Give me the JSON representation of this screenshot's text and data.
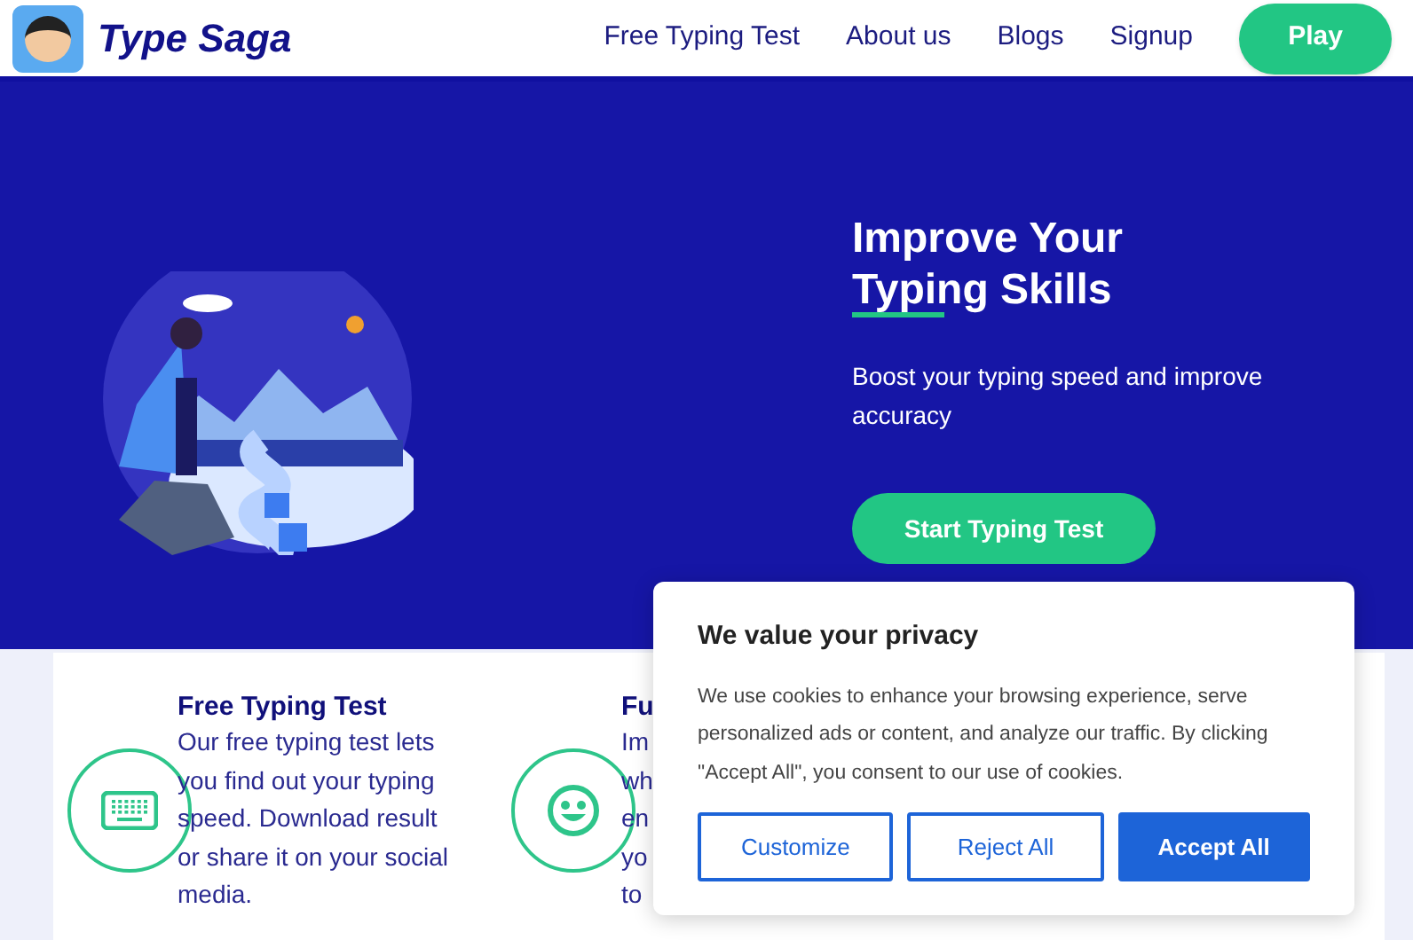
{
  "header": {
    "logo_text": "Type Saga",
    "nav": [
      "Free Typing Test",
      "About us",
      "Blogs",
      "Signup"
    ],
    "play_button": "Play"
  },
  "hero": {
    "title_line_1": "Improve Your",
    "title_line_2": "Typing Skills",
    "subtitle": "Boost your typing speed and improve accuracy",
    "cta": "Start Typing Test"
  },
  "features": [
    {
      "kind": "keyboard",
      "title": "Free Typing Test",
      "lines": [
        "Our free typing test lets",
        "you find out your typing",
        "speed. Download result",
        "or share it on your social",
        "media."
      ]
    },
    {
      "kind": "smiley",
      "title": "Fu",
      "lines": [
        "Im",
        "wh",
        "en",
        "yo",
        "to"
      ]
    }
  ],
  "cookie_dialog": {
    "title": "We value your privacy",
    "text": "We use cookies to enhance your browsing experience, serve personalized ads or content, and analyze our traffic. By clicking \"Accept All\", you consent to our use of cookies.",
    "buttons": [
      {
        "label": "Customize",
        "kind": "outline"
      },
      {
        "label": "Reject All",
        "kind": "outline"
      },
      {
        "label": "Accept All",
        "kind": "filled"
      }
    ]
  }
}
